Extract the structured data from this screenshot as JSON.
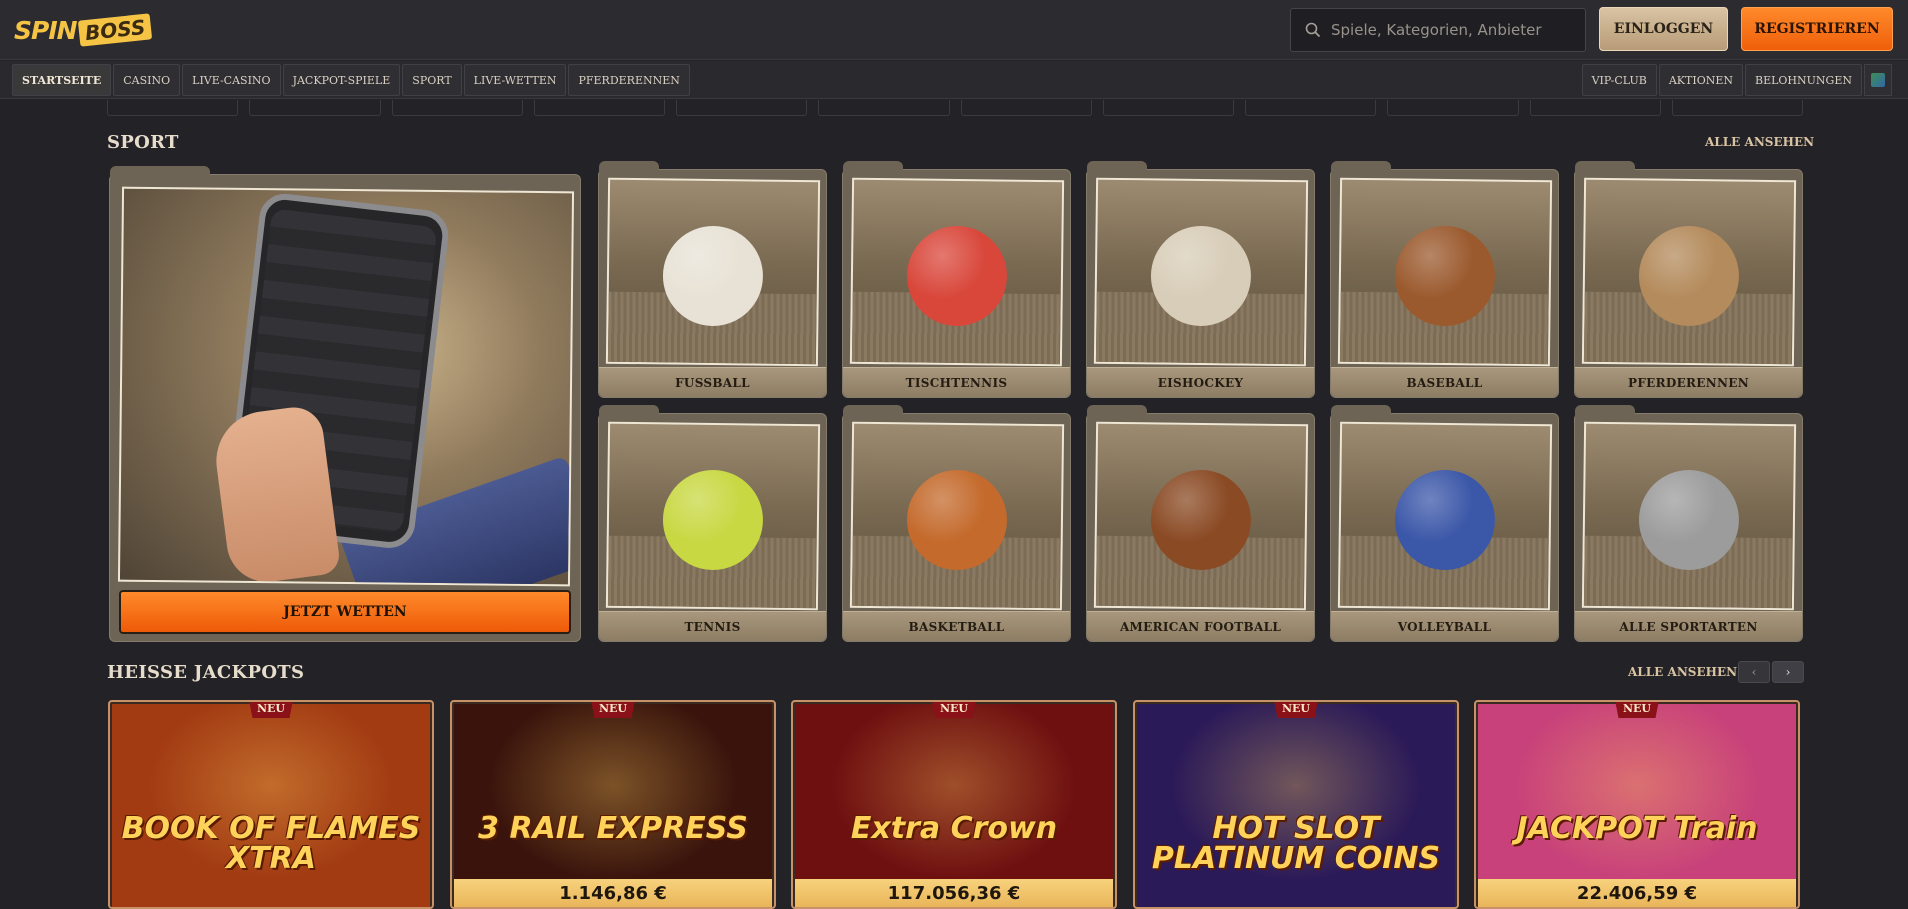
{
  "brand": {
    "logo_spin": "SPIN",
    "logo_boss": "BOSS"
  },
  "header": {
    "search_placeholder": "Spiele, Kategorien, Anbieter",
    "login_label": "EINLOGGEN",
    "register_label": "REGISTRIEREN"
  },
  "nav": {
    "left": [
      "STARTSEITE",
      "CASINO",
      "LIVE-CASINO",
      "JACKPOT-SPIELE",
      "SPORT",
      "LIVE-WETTEN",
      "PFERDERENNEN"
    ],
    "right": [
      "VIP-CLUB",
      "AKTIONEN",
      "BELOHNUNGEN"
    ],
    "active": "STARTSEITE"
  },
  "sport": {
    "title": "SPORT",
    "see_all": "ALLE ANSEHEN",
    "cta_label": "JETZT WETTEN",
    "cards": [
      {
        "label": "FUSSBALL",
        "color": "#e8e2d6"
      },
      {
        "label": "TISCHTENNIS",
        "color": "#d9473b"
      },
      {
        "label": "EISHOCKEY",
        "color": "#d8cdb8"
      },
      {
        "label": "BASEBALL",
        "color": "#9b5a2e"
      },
      {
        "label": "PFERDERENNEN",
        "color": "#b48b5c"
      },
      {
        "label": "TENNIS",
        "color": "#c8d843"
      },
      {
        "label": "BASKETBALL",
        "color": "#c46a2c"
      },
      {
        "label": "AMERICAN FOOTBALL",
        "color": "#8a4a24"
      },
      {
        "label": "VOLLEYBALL",
        "color": "#3b57a8"
      },
      {
        "label": "ALLE SPORTARTEN",
        "color": "#9c9c9c"
      }
    ]
  },
  "jackpots": {
    "title": "HEISSE JACKPOTS",
    "see_all": "ALLE ANSEHEN",
    "prev": "‹",
    "next": "›",
    "items": [
      {
        "badge": "NEU",
        "name": "BOOK OF FLAMES XTRA",
        "amount": "",
        "bg": "#a23a12"
      },
      {
        "badge": "NEU",
        "name": "3 RAIL EXPRESS",
        "amount": "1.146,86 €",
        "bg": "#3a140c"
      },
      {
        "badge": "NEU",
        "name": "Extra Crown",
        "amount": "117.056,36 €",
        "bg": "#6e0f10"
      },
      {
        "badge": "NEU",
        "name": "HOT SLOT PLATINUM COINS",
        "amount": "",
        "bg": "#2b1a58"
      },
      {
        "badge": "NEU",
        "name": "JACKPOT Train",
        "amount": "22.406,59 €",
        "bg": "#c8417a"
      }
    ]
  }
}
